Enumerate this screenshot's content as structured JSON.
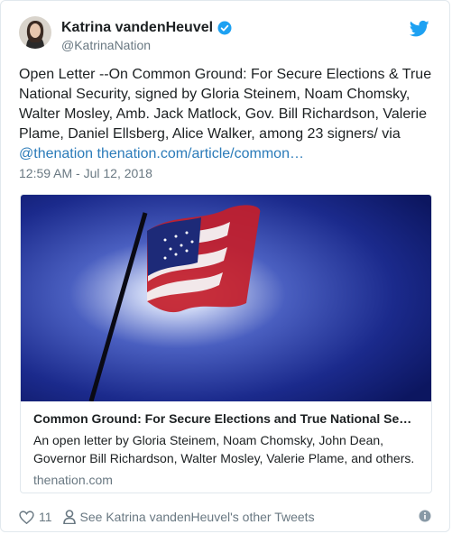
{
  "author": {
    "display_name": "Katrina vandenHeuvel",
    "handle": "@KatrinaNation"
  },
  "tweet": {
    "text": "Open Letter --On Common Ground: For Secure Elections & True National Security, signed by Gloria Steinem, Noam Chomsky, Walter Mosley, Amb. Jack Matlock, Gov. Bill Richardson, Valerie Plame, Daniel Ellsberg, Alice Walker, among 23 signers/ via ",
    "mention": "@thenation",
    "url": "thenation.com/article/common…",
    "timestamp": "12:59 AM - Jul 12, 2018"
  },
  "card": {
    "title": "Common Ground: For Secure Elections and True National Sec…",
    "description": "An open letter by Gloria Steinem, Noam Chomsky, John Dean, Governor Bill Richardson, Walter Mosley, Valerie Plame, and others.",
    "domain": "thenation.com"
  },
  "footer": {
    "like_count": "11",
    "see_more_label": "See Katrina vandenHeuvel's other Tweets"
  },
  "colors": {
    "link": "#2b7bb9",
    "verified": "#1da1f2",
    "muted": "#697882"
  }
}
